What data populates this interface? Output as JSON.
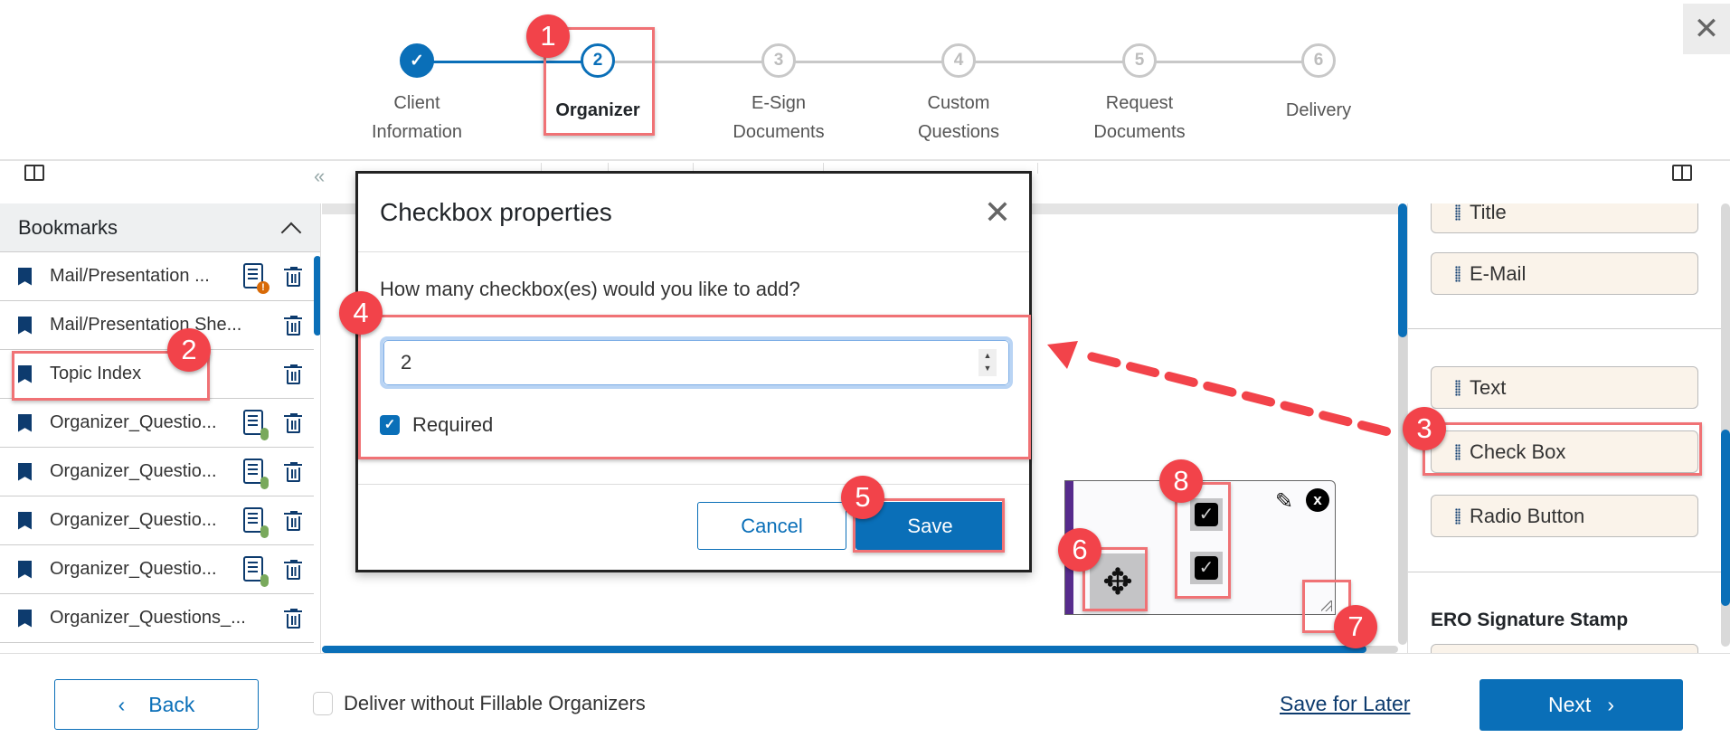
{
  "stepper": {
    "steps": [
      {
        "number": "✓",
        "label_line1": "Client",
        "label_line2": "Information",
        "state": "done"
      },
      {
        "number": "2",
        "label_line1": "Organizer",
        "label_line2": "",
        "state": "active"
      },
      {
        "number": "3",
        "label_line1": "E-Sign",
        "label_line2": "Documents",
        "state": "pending"
      },
      {
        "number": "4",
        "label_line1": "Custom",
        "label_line2": "Questions",
        "state": "pending"
      },
      {
        "number": "5",
        "label_line1": "Request",
        "label_line2": "Documents",
        "state": "pending"
      },
      {
        "number": "6",
        "label_line1": "Delivery",
        "label_line2": "",
        "state": "pending"
      }
    ],
    "close_glyph": "✕"
  },
  "toolbar": {
    "collapse_glyph": "«"
  },
  "bookmarks": {
    "title": "Bookmarks",
    "items": [
      {
        "label": "Mail/Presentation ...",
        "doc_icon": "warning"
      },
      {
        "label": "Mail/Presentation She...",
        "doc_icon": "none"
      },
      {
        "label": "Topic Index",
        "doc_icon": "none"
      },
      {
        "label": "Organizer_Questio...",
        "doc_icon": "attachment"
      },
      {
        "label": "Organizer_Questio...",
        "doc_icon": "attachment"
      },
      {
        "label": "Organizer_Questio...",
        "doc_icon": "attachment"
      },
      {
        "label": "Organizer_Questio...",
        "doc_icon": "attachment"
      },
      {
        "label": "Organizer_Questions_...",
        "doc_icon": "none"
      }
    ],
    "warning_glyph": "!"
  },
  "modal": {
    "title": "Checkbox properties",
    "close_glyph": "✕",
    "question": "How many checkbox(es) would you like to add?",
    "count_value": "2",
    "required_label": "Required",
    "required_checked": true,
    "cancel_label": "Cancel",
    "save_label": "Save"
  },
  "checkbox_widget": {
    "move_glyph": "✥",
    "check_glyph": "✓",
    "pencil_glyph": "✎",
    "close_glyph": "x",
    "checkbox_count": 2
  },
  "right_panel": {
    "fields_top": [
      "Title",
      "E-Mail"
    ],
    "fields_bottom": [
      "Text",
      "Check Box",
      "Radio Button"
    ],
    "section_heading": "ERO Signature Stamp"
  },
  "annotations": {
    "badges": [
      "1",
      "2",
      "3",
      "4",
      "5",
      "6",
      "7",
      "8"
    ],
    "highlight_color": "#f07275",
    "badge_color": "#f2434a"
  },
  "footer": {
    "back_label": "Back",
    "back_glyph": "‹",
    "deliver_label": "Deliver without Fillable Organizers",
    "deliver_checked": false,
    "save_later_label": "Save for Later",
    "next_label": "Next",
    "next_glyph": "›"
  },
  "colors": {
    "primary": "#0a6fb8",
    "navy": "#0d3b6e",
    "field_bg": "#faf3ea",
    "widget_accent": "#562b8c"
  }
}
